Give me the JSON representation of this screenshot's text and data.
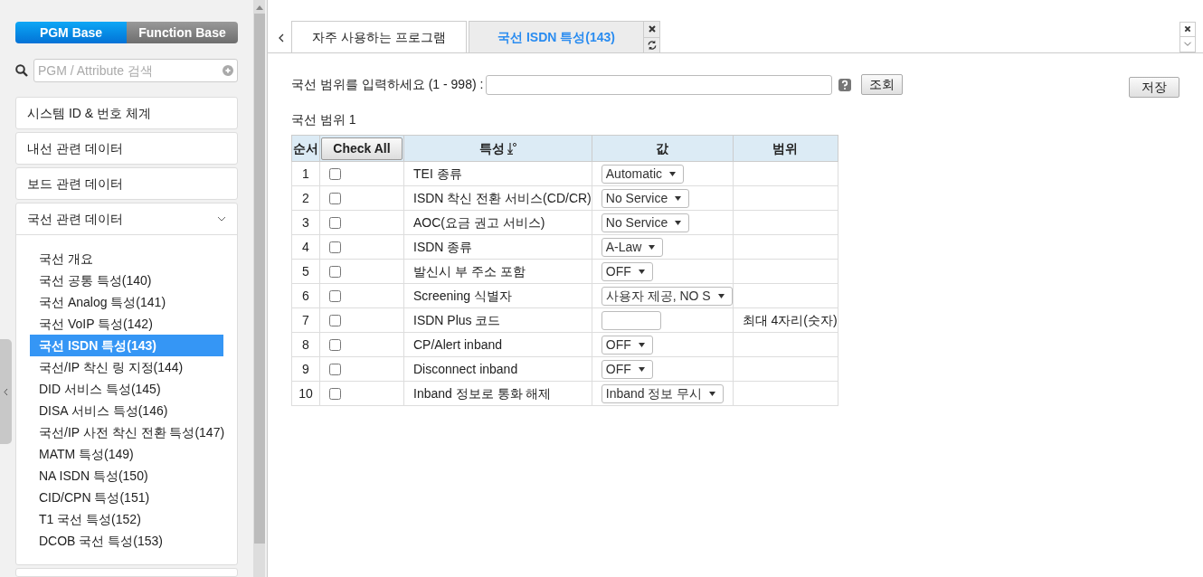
{
  "sidebar": {
    "mode_tabs": [
      {
        "label": "PGM Base",
        "selected": true
      },
      {
        "label": "Function Base",
        "selected": false
      }
    ],
    "search": {
      "placeholder": "PGM / Attribute 검색"
    },
    "menu": [
      {
        "label": "시스템 ID & 번호 체계",
        "expanded": false
      },
      {
        "label": "내선 관련 데이터",
        "expanded": false
      },
      {
        "label": "보드 관련 데이터",
        "expanded": false
      },
      {
        "label": "국선 관련 데이터",
        "expanded": true,
        "children": [
          {
            "label": "국선 개요",
            "selected": false
          },
          {
            "label": "국선 공통 특성(140)",
            "selected": false
          },
          {
            "label": "국선 Analog 특성(141)",
            "selected": false
          },
          {
            "label": "국선 VoIP 특성(142)",
            "selected": false
          },
          {
            "label": "국선 ISDN 특성(143)",
            "selected": true
          },
          {
            "label": "국선/IP 착신 링 지정(144)",
            "selected": false
          },
          {
            "label": "DID 서비스 특성(145)",
            "selected": false
          },
          {
            "label": "DISA 서비스 특성(146)",
            "selected": false
          },
          {
            "label": "국선/IP 사전 착신 전환 특성(147)",
            "selected": false
          },
          {
            "label": "MATM 특성(149)",
            "selected": false
          },
          {
            "label": "NA ISDN 특성(150)",
            "selected": false
          },
          {
            "label": "CID/CPN 특성(151)",
            "selected": false
          },
          {
            "label": "T1 국선 특성(152)",
            "selected": false
          },
          {
            "label": "DCOB 국선 특성(153)",
            "selected": false
          }
        ]
      }
    ]
  },
  "tabs": [
    {
      "label": "자주 사용하는 프로그램",
      "selected": false
    },
    {
      "label": "국선 ISDN 특성(143)",
      "selected": true
    }
  ],
  "form": {
    "label": "국선 범위를 입력하세요 (1 - 998) :",
    "query_button": "조회",
    "save_button": "저장"
  },
  "section_title": "국선 범위 1",
  "table": {
    "columns": [
      "순서",
      "Check All",
      "특성",
      "값",
      "범위"
    ],
    "rows": [
      {
        "index": "1",
        "checked": false,
        "attribute": "TEI 종류",
        "value": {
          "kind": "select",
          "text": "Automatic"
        }
      },
      {
        "index": "2",
        "checked": false,
        "attribute": "ISDN 착신 전환 서비스(CD/CR)",
        "value": {
          "kind": "select",
          "text": "No Service"
        }
      },
      {
        "index": "3",
        "checked": false,
        "attribute": "AOC(요금 권고 서비스)",
        "value": {
          "kind": "select",
          "text": "No Service"
        }
      },
      {
        "index": "4",
        "checked": false,
        "attribute": "ISDN 종류",
        "value": {
          "kind": "select",
          "text": "A-Law"
        }
      },
      {
        "index": "5",
        "checked": false,
        "attribute": "발신시 부 주소 포함",
        "value": {
          "kind": "select",
          "text": "OFF"
        }
      },
      {
        "index": "6",
        "checked": false,
        "attribute": "Screening 식별자",
        "value": {
          "kind": "select",
          "text": "사용자 제공, NO S"
        }
      },
      {
        "index": "7",
        "checked": false,
        "attribute": "ISDN Plus 코드",
        "value": {
          "kind": "input"
        },
        "range": "최대 4자리(숫자)"
      },
      {
        "index": "8",
        "checked": false,
        "attribute": "CP/Alert inband",
        "value": {
          "kind": "select",
          "text": "OFF"
        }
      },
      {
        "index": "9",
        "checked": false,
        "attribute": "Disconnect inband",
        "value": {
          "kind": "select",
          "text": "OFF"
        }
      },
      {
        "index": "10",
        "checked": false,
        "attribute": "Inband 정보로 통화 해제",
        "value": {
          "kind": "select",
          "text": "Inband 정보 무시"
        }
      }
    ]
  }
}
